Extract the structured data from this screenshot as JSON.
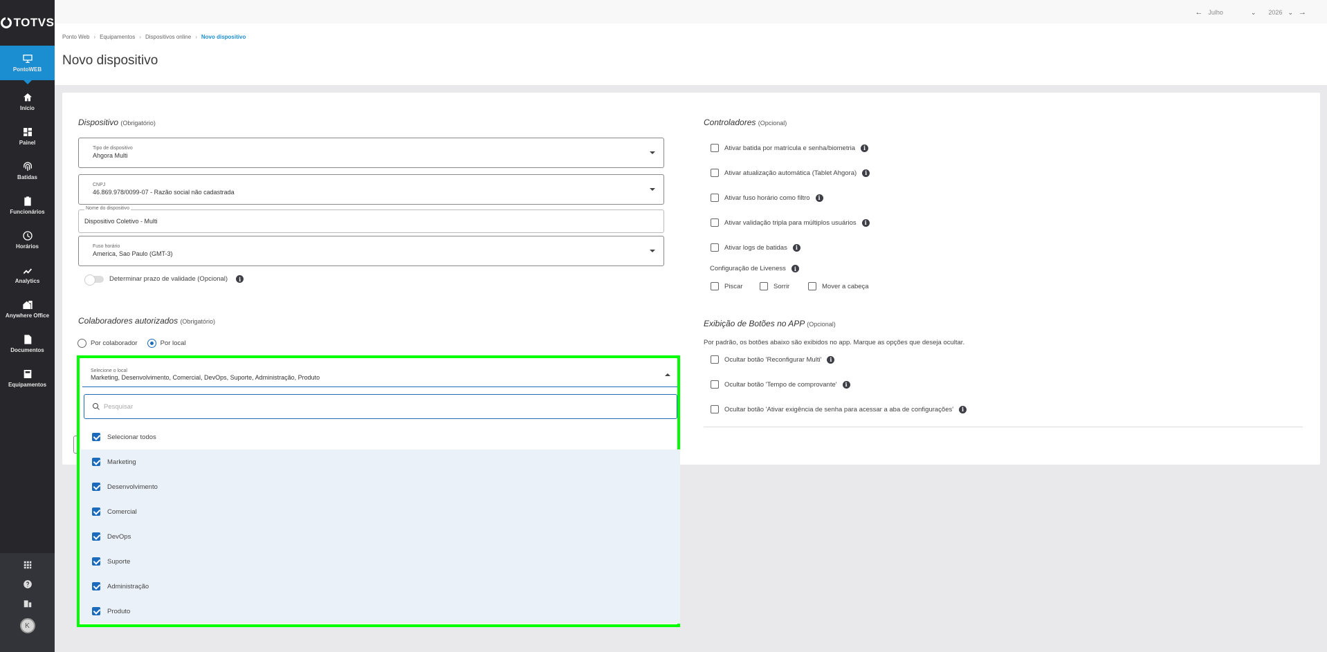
{
  "sidebar": {
    "logo": "TOTVS",
    "items": [
      {
        "label": "PontoWEB",
        "icon": "monitor-icon"
      },
      {
        "label": "Início",
        "icon": "home-icon"
      },
      {
        "label": "Painel",
        "icon": "dashboard-icon"
      },
      {
        "label": "Batidas",
        "icon": "fingerprint-icon"
      },
      {
        "label": "Funcionários",
        "icon": "badge-icon"
      },
      {
        "label": "Horários",
        "icon": "clock-icon"
      },
      {
        "label": "Analytics",
        "icon": "trending-icon"
      },
      {
        "label": "Anywhere Office",
        "icon": "house-office-icon"
      },
      {
        "label": "Documentos",
        "icon": "document-icon"
      },
      {
        "label": "Equipamentos",
        "icon": "equipment-icon"
      }
    ],
    "bottom": {
      "avatar_initial": "K"
    }
  },
  "topbar": {
    "month": "Julho",
    "year": "2026"
  },
  "breadcrumb": [
    "Ponto Web",
    "Equipamentos",
    "Dispositivos online",
    "Novo dispositivo"
  ],
  "page_title": "Novo dispositivo",
  "device": {
    "title": "Dispositivo",
    "note": "(Obrigatório)",
    "type_label": "Tipo de dispositivo",
    "type_value": "Ahgora Multi",
    "cnpj_label": "CNPJ",
    "cnpj_value": "46.869.978/0099-07 - Razão social não cadastrada",
    "name_label": "Nome do dispositivo",
    "name_value": "Dispositivo Coletivo - Multi",
    "tz_label": "Fuso horário",
    "tz_value": "America, Sao Paulo (GMT-3)",
    "validity_label": "Determinar prazo de validade (Opcional)"
  },
  "collaborators": {
    "title": "Colaboradores autorizados",
    "note": "(Obrigatório)",
    "radio_by_collaborator": "Por colaborador",
    "radio_by_location": "Por local",
    "select_label": "Selecione o local",
    "select_value": "Marketing, Desenvolvimento, Comercial, DevOps, Suporte, Administração, Produto",
    "search_placeholder": "Pesquisar",
    "options": [
      {
        "label": "Selecionar todos",
        "checked": true
      },
      {
        "label": "Marketing",
        "checked": true
      },
      {
        "label": "Desenvolvimento",
        "checked": true
      },
      {
        "label": "Comercial",
        "checked": true
      },
      {
        "label": "DevOps",
        "checked": true
      },
      {
        "label": "Suporte",
        "checked": true
      },
      {
        "label": "Administração",
        "checked": true
      },
      {
        "label": "Produto",
        "checked": true
      }
    ]
  },
  "controllers": {
    "title": "Controladores",
    "note": "(Opcional)",
    "items": [
      "Ativar batida por matrícula e senha/biometria",
      "Ativar atualização automática (Tablet Ahgora)",
      "Ativar fuso horário como filtro",
      "Ativar validação tripla para múltiplos usuários",
      "Ativar logs de batidas"
    ],
    "liveness_label": "Configuração de Liveness",
    "liveness": [
      "Piscar",
      "Sorrir",
      "Mover a cabeça"
    ]
  },
  "app_buttons": {
    "title": "Exibição de Botões no APP",
    "note": "(Opcional)",
    "description": "Por padrão, os botões abaixo são exibidos no app. Marque as opções que deseja ocultar.",
    "items": [
      "Ocultar botão 'Reconfigurar Multi'",
      "Ocultar botão 'Tempo de comprovante'",
      "Ocultar botão 'Ativar exigência de senha para acessar a aba de configurações'"
    ]
  },
  "colors": {
    "accent": "#1b8ed1",
    "sidebar": "#26262b",
    "highlight_frame": "#00ff00"
  }
}
